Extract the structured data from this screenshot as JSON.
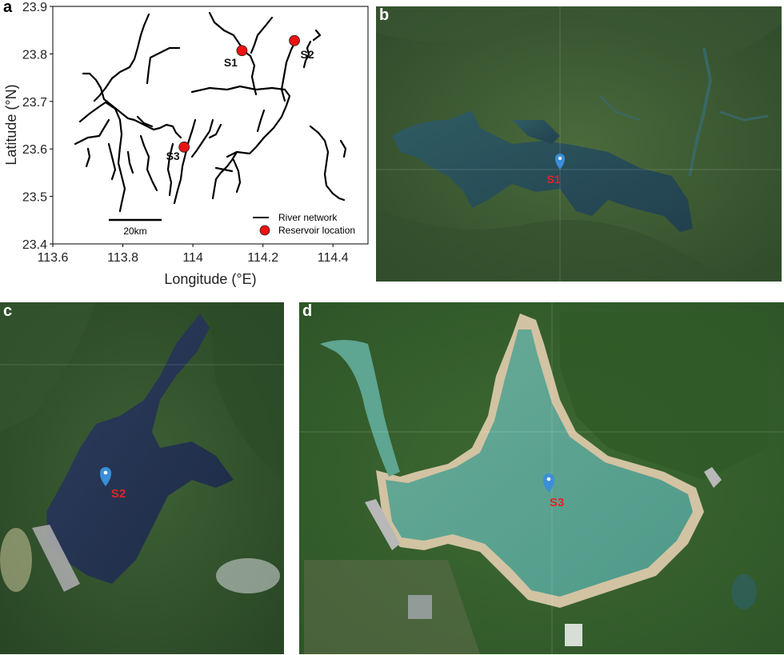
{
  "panels": {
    "a": {
      "letter": "a",
      "xlabel": "Longitude (°E)",
      "ylabel": "Latitude (°N)",
      "xticks": [
        "113.6",
        "113.8",
        "114",
        "114.2",
        "114.4"
      ],
      "yticks": [
        "23.4",
        "23.5",
        "23.6",
        "23.7",
        "23.8",
        "23.9"
      ],
      "xlim": [
        113.6,
        114.5
      ],
      "ylim": [
        23.4,
        23.9
      ],
      "scale_bar_label": "20km",
      "legend": {
        "river": "River network",
        "reservoir": "Reservoir location"
      },
      "sites": [
        {
          "label": "S1",
          "lon": 114.14,
          "lat": 23.807
        },
        {
          "label": "S2",
          "lon": 114.29,
          "lat": 23.828
        },
        {
          "label": "S3",
          "lon": 113.975,
          "lat": 23.604
        }
      ]
    },
    "b": {
      "letter": "b",
      "marker_label": "S1"
    },
    "c": {
      "letter": "c",
      "marker_label": "S2"
    },
    "d": {
      "letter": "d",
      "marker_label": "S3"
    }
  },
  "colors": {
    "reservoir_marker": "#ee1111",
    "river": "#000000",
    "pin": "#3a8fd8",
    "satellite_label": "#e8202a"
  }
}
